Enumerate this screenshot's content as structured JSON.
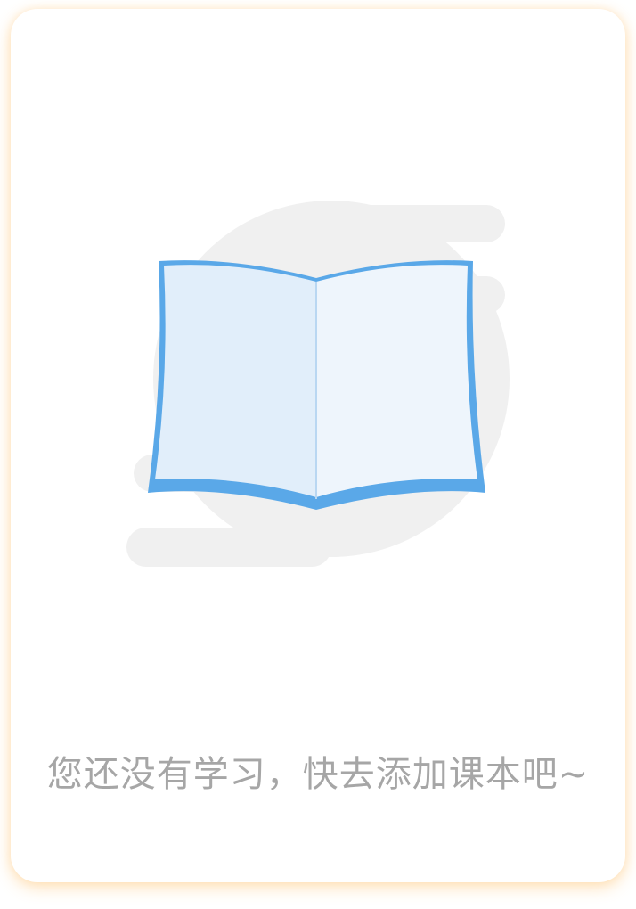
{
  "empty_state": {
    "message": "您还没有学习，快去添加课本吧~",
    "icon": "open-book-icon"
  },
  "colors": {
    "card_shadow": "#ffd9a3",
    "backdrop_gray": "#f0f0f0",
    "book_stroke": "#5aa8e8",
    "book_page_left": "#e1eefa",
    "book_page_right": "#eef5fc",
    "message_text": "#a6a6a6"
  }
}
